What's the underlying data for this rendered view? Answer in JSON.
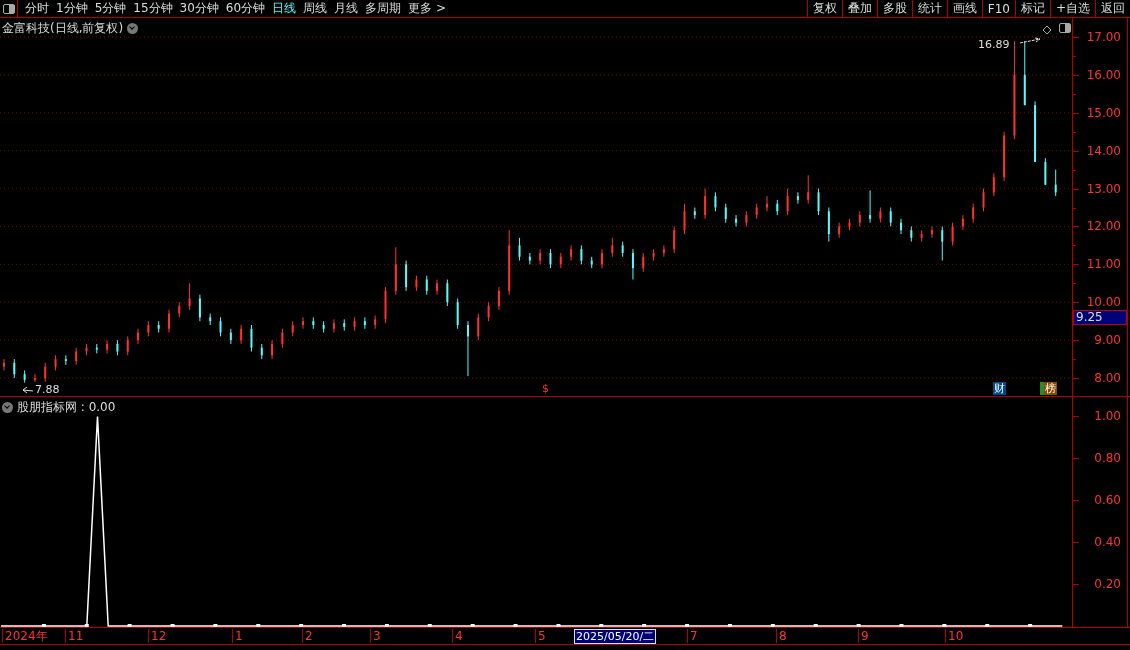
{
  "toolbar": {
    "periods": [
      {
        "label": "分时",
        "selected": false
      },
      {
        "label": "1分钟",
        "selected": false
      },
      {
        "label": "5分钟",
        "selected": false
      },
      {
        "label": "15分钟",
        "selected": false
      },
      {
        "label": "30分钟",
        "selected": false
      },
      {
        "label": "60分钟",
        "selected": false
      },
      {
        "label": "日线",
        "selected": true
      },
      {
        "label": "周线",
        "selected": false
      },
      {
        "label": "月线",
        "selected": false
      },
      {
        "label": "多周期",
        "selected": false
      },
      {
        "label": "更多 >",
        "selected": false
      }
    ],
    "buttons": [
      "复权",
      "叠加",
      "多股",
      "统计",
      "画线",
      "F10",
      "标记",
      "+自选",
      "返回"
    ]
  },
  "price_panel": {
    "title": "金富科技(日线,前复权)",
    "high_label": "16.89",
    "low_label": "7.88",
    "event_marks": [
      {
        "label": "$",
        "kind": "dividend"
      },
      {
        "label": "财",
        "kind": "finance"
      },
      {
        "label": "榜",
        "kind": "ranking"
      }
    ],
    "cursor_price": "9.25",
    "chart_data": {
      "type": "candlestick",
      "grid": true,
      "ylim": [
        7.5,
        17.5
      ],
      "yticks": [
        {
          "value": 8,
          "label": "8.00"
        },
        {
          "value": 9,
          "label": "9.00"
        },
        {
          "value": 10,
          "label": "10.00"
        },
        {
          "value": 11,
          "label": "11.00"
        },
        {
          "value": 12,
          "label": "12.00"
        },
        {
          "value": 13,
          "label": "13.00"
        },
        {
          "value": 14,
          "label": "14.00"
        },
        {
          "value": 15,
          "label": "15.00"
        },
        {
          "value": 16,
          "label": "16.00"
        },
        {
          "value": 17,
          "label": "17.00"
        }
      ],
      "ohlc": [
        [
          8.3,
          8.5,
          8.2,
          8.4
        ],
        [
          8.4,
          8.5,
          8.0,
          8.1
        ],
        [
          8.1,
          8.2,
          7.88,
          7.95
        ],
        [
          7.95,
          8.1,
          7.9,
          8.0
        ],
        [
          8.0,
          8.4,
          7.9,
          8.3
        ],
        [
          8.3,
          8.6,
          8.2,
          8.5
        ],
        [
          8.5,
          8.6,
          8.35,
          8.45
        ],
        [
          8.45,
          8.8,
          8.35,
          8.7
        ],
        [
          8.7,
          8.9,
          8.6,
          8.8
        ],
        [
          8.8,
          8.9,
          8.65,
          8.75
        ],
        [
          8.75,
          9.0,
          8.65,
          8.9
        ],
        [
          8.9,
          9.0,
          8.6,
          8.7
        ],
        [
          8.7,
          9.1,
          8.6,
          9.0
        ],
        [
          9.0,
          9.3,
          8.9,
          9.2
        ],
        [
          9.2,
          9.5,
          9.1,
          9.4
        ],
        [
          9.4,
          9.5,
          9.2,
          9.3
        ],
        [
          9.3,
          9.8,
          9.2,
          9.7
        ],
        [
          9.7,
          10.0,
          9.6,
          9.9
        ],
        [
          9.9,
          10.5,
          9.8,
          10.1
        ],
        [
          10.1,
          10.2,
          9.5,
          9.6
        ],
        [
          9.6,
          9.7,
          9.4,
          9.5
        ],
        [
          9.5,
          9.6,
          9.1,
          9.2
        ],
        [
          9.2,
          9.3,
          8.9,
          9.0
        ],
        [
          9.0,
          9.4,
          8.9,
          9.3
        ],
        [
          9.3,
          9.4,
          8.7,
          8.8
        ],
        [
          8.8,
          8.9,
          8.5,
          8.6
        ],
        [
          8.6,
          9.0,
          8.5,
          8.9
        ],
        [
          8.9,
          9.3,
          8.8,
          9.2
        ],
        [
          9.2,
          9.5,
          9.1,
          9.4
        ],
        [
          9.4,
          9.6,
          9.3,
          9.5
        ],
        [
          9.5,
          9.6,
          9.3,
          9.4
        ],
        [
          9.4,
          9.5,
          9.2,
          9.3
        ],
        [
          9.3,
          9.55,
          9.2,
          9.45
        ],
        [
          9.45,
          9.55,
          9.25,
          9.35
        ],
        [
          9.35,
          9.6,
          9.25,
          9.5
        ],
        [
          9.5,
          9.6,
          9.3,
          9.4
        ],
        [
          9.4,
          9.65,
          9.3,
          9.55
        ],
        [
          9.55,
          10.4,
          9.45,
          10.3
        ],
        [
          10.3,
          11.45,
          10.2,
          11.0
        ],
        [
          11.0,
          11.1,
          10.3,
          10.4
        ],
        [
          10.4,
          10.7,
          10.3,
          10.6
        ],
        [
          10.6,
          10.7,
          10.2,
          10.3
        ],
        [
          10.3,
          10.6,
          10.2,
          10.5
        ],
        [
          10.5,
          10.6,
          9.9,
          10.0
        ],
        [
          10.0,
          10.1,
          9.3,
          9.4
        ],
        [
          9.4,
          9.5,
          8.05,
          9.1
        ],
        [
          9.1,
          9.7,
          9.0,
          9.6
        ],
        [
          9.6,
          10.0,
          9.5,
          9.9
        ],
        [
          9.9,
          10.4,
          9.8,
          10.3
        ],
        [
          10.3,
          11.9,
          10.2,
          11.5
        ],
        [
          11.5,
          11.7,
          11.1,
          11.2
        ],
        [
          11.2,
          11.3,
          11.0,
          11.1
        ],
        [
          11.1,
          11.4,
          11.0,
          11.3
        ],
        [
          11.3,
          11.4,
          10.9,
          11.0
        ],
        [
          11.0,
          11.3,
          10.9,
          11.2
        ],
        [
          11.2,
          11.5,
          11.1,
          11.4
        ],
        [
          11.4,
          11.5,
          11.0,
          11.1
        ],
        [
          11.1,
          11.2,
          10.9,
          11.0
        ],
        [
          11.0,
          11.4,
          10.9,
          11.3
        ],
        [
          11.3,
          11.7,
          11.2,
          11.5
        ],
        [
          11.5,
          11.6,
          11.2,
          11.3
        ],
        [
          11.3,
          11.4,
          10.6,
          10.9
        ],
        [
          10.9,
          11.3,
          10.8,
          11.2
        ],
        [
          11.2,
          11.4,
          11.1,
          11.3
        ],
        [
          11.3,
          11.5,
          11.2,
          11.4
        ],
        [
          11.4,
          12.0,
          11.3,
          11.9
        ],
        [
          11.9,
          12.6,
          11.8,
          12.4
        ],
        [
          12.4,
          12.5,
          12.2,
          12.3
        ],
        [
          12.3,
          13.0,
          12.2,
          12.8
        ],
        [
          12.8,
          12.9,
          12.4,
          12.5
        ],
        [
          12.5,
          12.6,
          12.1,
          12.2
        ],
        [
          12.2,
          12.3,
          12.0,
          12.1
        ],
        [
          12.1,
          12.4,
          12.0,
          12.3
        ],
        [
          12.3,
          12.6,
          12.2,
          12.5
        ],
        [
          12.5,
          12.8,
          12.4,
          12.6
        ],
        [
          12.6,
          12.7,
          12.3,
          12.4
        ],
        [
          12.4,
          13.0,
          12.3,
          12.8
        ],
        [
          12.8,
          12.9,
          12.6,
          12.7
        ],
        [
          12.7,
          13.35,
          12.6,
          12.9
        ],
        [
          12.9,
          13.0,
          12.3,
          12.4
        ],
        [
          12.4,
          12.5,
          11.6,
          11.8
        ],
        [
          11.8,
          12.1,
          11.7,
          12.0
        ],
        [
          12.0,
          12.2,
          11.9,
          12.1
        ],
        [
          12.1,
          12.4,
          12.0,
          12.3
        ],
        [
          12.3,
          12.95,
          12.1,
          12.2
        ],
        [
          12.2,
          12.5,
          12.1,
          12.4
        ],
        [
          12.4,
          12.5,
          12.0,
          12.1
        ],
        [
          12.1,
          12.2,
          11.8,
          11.9
        ],
        [
          11.9,
          12.0,
          11.6,
          11.7
        ],
        [
          11.7,
          11.9,
          11.6,
          11.8
        ],
        [
          11.8,
          12.0,
          11.7,
          11.9
        ],
        [
          11.9,
          12.0,
          11.1,
          11.6
        ],
        [
          11.6,
          12.1,
          11.5,
          12.0
        ],
        [
          12.0,
          12.3,
          11.9,
          12.2
        ],
        [
          12.2,
          12.6,
          12.1,
          12.5
        ],
        [
          12.5,
          13.0,
          12.4,
          12.9
        ],
        [
          12.9,
          13.4,
          12.8,
          13.3
        ],
        [
          13.3,
          14.5,
          13.2,
          14.4
        ],
        [
          14.4,
          16.89,
          14.3,
          16.0
        ],
        [
          16.0,
          16.89,
          15.2,
          15.2
        ],
        [
          15.2,
          15.3,
          13.7,
          13.7
        ],
        [
          13.7,
          13.8,
          13.1,
          13.1
        ],
        [
          13.1,
          13.5,
          12.8,
          12.9
        ]
      ]
    }
  },
  "indicator_panel": {
    "name": "股朋指标网",
    "reading": ": 0.00",
    "chart_data": {
      "type": "line",
      "ylim": [
        0,
        1.1
      ],
      "yticks": [
        {
          "value": 0.2,
          "label": "0.20"
        },
        {
          "value": 0.4,
          "label": "0.40"
        },
        {
          "value": 0.6,
          "label": "0.60"
        },
        {
          "value": 0.8,
          "label": "0.80"
        },
        {
          "value": 1.0,
          "label": "1.00"
        }
      ],
      "series": [
        {
          "color": "#ffffff",
          "values": [
            0,
            0,
            0,
            0,
            0,
            0,
            0,
            0,
            0,
            1,
            0,
            0,
            0,
            0,
            0,
            0,
            0,
            0,
            0,
            0,
            0,
            0,
            0,
            0,
            0,
            0,
            0,
            0,
            0,
            0,
            0,
            0,
            0,
            0,
            0,
            0,
            0,
            0,
            0,
            0,
            0,
            0,
            0,
            0,
            0,
            0,
            0,
            0,
            0,
            0,
            0,
            0,
            0,
            0,
            0,
            0,
            0,
            0,
            0,
            0,
            0,
            0,
            0,
            0,
            0,
            0,
            0,
            0,
            0,
            0,
            0,
            0,
            0,
            0,
            0,
            0,
            0,
            0,
            0,
            0,
            0,
            0,
            0,
            0,
            0,
            0,
            0,
            0,
            0,
            0,
            0,
            0,
            0,
            0,
            0,
            0,
            0,
            0,
            0,
            0
          ]
        }
      ]
    }
  },
  "date_axis": {
    "labels": [
      "2024年",
      "11",
      "12",
      "1",
      "2",
      "3",
      "4",
      "5",
      "7",
      "8",
      "9",
      "10"
    ],
    "cursor_date": "2025/05/20/二"
  }
}
